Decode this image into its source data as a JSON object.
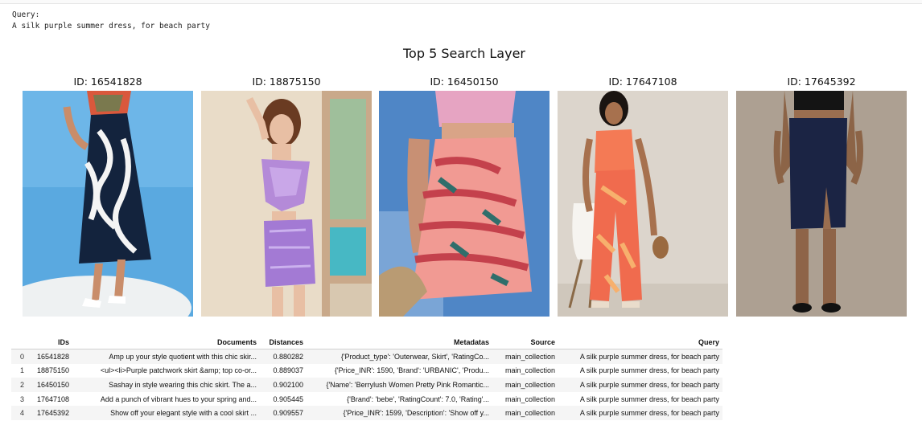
{
  "query_label": "Query:",
  "query_text": "A silk purple summer dress, for beach party",
  "figure_title": "Top 5 Search Layer",
  "panels": [
    {
      "id_label": "ID: 16541828"
    },
    {
      "id_label": "ID: 18875150"
    },
    {
      "id_label": "ID: 16450150"
    },
    {
      "id_label": "ID: 17647108"
    },
    {
      "id_label": "ID: 17645392"
    }
  ],
  "table": {
    "headers": {
      "index": "",
      "ids": "IDs",
      "documents": "Documents",
      "distances": "Distances",
      "metadatas": "Metadatas",
      "source": "Source",
      "query": "Query"
    },
    "rows": [
      {
        "index": "0",
        "ids": "16541828",
        "documents": "Amp up your style quotient with this chic skir...",
        "distances": "0.880282",
        "metadatas": "{'Product_type': 'Outerwear, Skirt', 'RatingCo...",
        "source": "main_collection",
        "query": "A silk purple summer dress, for beach party"
      },
      {
        "index": "1",
        "ids": "18875150",
        "documents": "<ul><li>Purple patchwork skirt &amp; top co-or...",
        "distances": "0.889037",
        "metadatas": "{'Price_INR': 1590, 'Brand': 'URBANIC', 'Produ...",
        "source": "main_collection",
        "query": "A silk purple summer dress, for beach party"
      },
      {
        "index": "2",
        "ids": "16450150",
        "documents": "Sashay in style wearing this chic skirt. The a...",
        "distances": "0.902100",
        "metadatas": "{'Name': 'Berrylush Women Pretty Pink Romantic...",
        "source": "main_collection",
        "query": "A silk purple summer dress, for beach party"
      },
      {
        "index": "3",
        "ids": "17647108",
        "documents": "Add a punch of vibrant hues to your spring and...",
        "distances": "0.905445",
        "metadatas": "{'Brand': 'bebe', 'RatingCount': 7.0, 'Rating'...",
        "source": "main_collection",
        "query": "A silk purple summer dress, for beach party"
      },
      {
        "index": "4",
        "ids": "17645392",
        "documents": "Show off your elegant style with a cool skirt ...",
        "distances": "0.909557",
        "metadatas": "{'Price_INR': 1599, 'Description': 'Show off y...",
        "source": "main_collection",
        "query": "A silk purple summer dress, for beach party"
      }
    ]
  }
}
